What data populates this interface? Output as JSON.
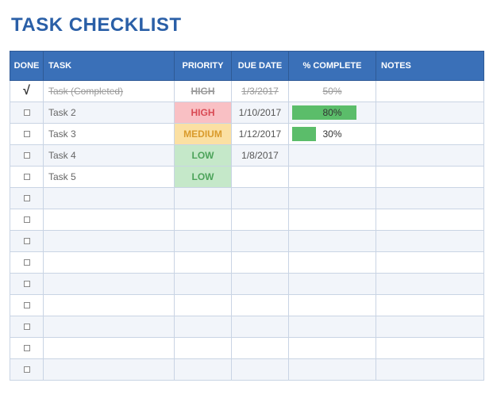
{
  "title": "TASK CHECKLIST",
  "columns": {
    "done": "DONE",
    "task": "TASK",
    "priority": "PRIORITY",
    "due": "DUE DATE",
    "pct": "% COMPLETE",
    "notes": "NOTES"
  },
  "rows": [
    {
      "done": true,
      "task": "Task (Completed)",
      "priority": "HIGH",
      "due": "1/3/2017",
      "pct": "50%",
      "pct_val": 50,
      "notes": "",
      "completed": true
    },
    {
      "done": false,
      "task": "Task 2",
      "priority": "HIGH",
      "due": "1/10/2017",
      "pct": "80%",
      "pct_val": 80,
      "notes": "",
      "completed": false
    },
    {
      "done": false,
      "task": "Task 3",
      "priority": "MEDIUM",
      "due": "1/12/2017",
      "pct": "30%",
      "pct_val": 30,
      "notes": "",
      "completed": false
    },
    {
      "done": false,
      "task": "Task 4",
      "priority": "LOW",
      "due": "1/8/2017",
      "pct": "",
      "pct_val": null,
      "notes": "",
      "completed": false
    },
    {
      "done": false,
      "task": "Task 5",
      "priority": "LOW",
      "due": "",
      "pct": "",
      "pct_val": null,
      "notes": "",
      "completed": false
    },
    {
      "done": false,
      "task": "",
      "priority": "",
      "due": "",
      "pct": "",
      "pct_val": null,
      "notes": "",
      "completed": false
    },
    {
      "done": false,
      "task": "",
      "priority": "",
      "due": "",
      "pct": "",
      "pct_val": null,
      "notes": "",
      "completed": false
    },
    {
      "done": false,
      "task": "",
      "priority": "",
      "due": "",
      "pct": "",
      "pct_val": null,
      "notes": "",
      "completed": false
    },
    {
      "done": false,
      "task": "",
      "priority": "",
      "due": "",
      "pct": "",
      "pct_val": null,
      "notes": "",
      "completed": false
    },
    {
      "done": false,
      "task": "",
      "priority": "",
      "due": "",
      "pct": "",
      "pct_val": null,
      "notes": "",
      "completed": false
    },
    {
      "done": false,
      "task": "",
      "priority": "",
      "due": "",
      "pct": "",
      "pct_val": null,
      "notes": "",
      "completed": false
    },
    {
      "done": false,
      "task": "",
      "priority": "",
      "due": "",
      "pct": "",
      "pct_val": null,
      "notes": "",
      "completed": false
    },
    {
      "done": false,
      "task": "",
      "priority": "",
      "due": "",
      "pct": "",
      "pct_val": null,
      "notes": "",
      "completed": false
    },
    {
      "done": false,
      "task": "",
      "priority": "",
      "due": "",
      "pct": "",
      "pct_val": null,
      "notes": "",
      "completed": false
    }
  ]
}
